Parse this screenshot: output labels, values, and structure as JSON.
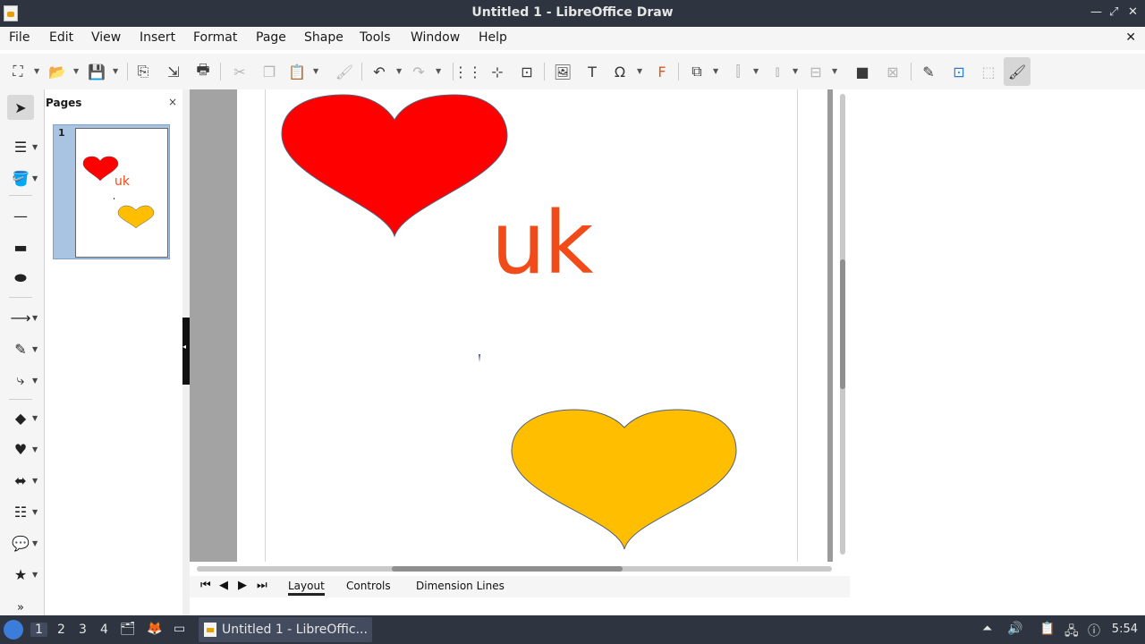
{
  "window": {
    "title": "Untitled 1 - LibreOffice Draw",
    "minimize_glyph": "—",
    "maximize_glyph": "⤢",
    "close_glyph": "✕"
  },
  "menubar": {
    "items": [
      "File",
      "Edit",
      "View",
      "Insert",
      "Format",
      "Page",
      "Shape",
      "Tools",
      "Window",
      "Help"
    ],
    "doc_close_glyph": "✕"
  },
  "toolbar": {
    "icons": [
      "select-mode-icon",
      "open-icon",
      "save-icon",
      "export-icon",
      "export-pdf-icon",
      "print-icon",
      "cut-icon",
      "copy-icon",
      "paste-icon",
      "clone-formatting-icon",
      "undo-icon",
      "redo-icon",
      "grid-icon",
      "helplines-icon",
      "zoom-pan-icon",
      "insert-image-icon",
      "insert-textbox-icon",
      "special-character-icon",
      "fontwork-icon",
      "transformations-icon",
      "align-icon",
      "arrange-icon",
      "distribute-icon",
      "shadow-icon",
      "crop-icon",
      "points-icon",
      "glue-points-icon",
      "toggle-extrusion-icon",
      "show-draw-functions-icon"
    ]
  },
  "pages_panel": {
    "header": "Pages",
    "close_glyph": "×",
    "pages": [
      {
        "number": "1",
        "thumb_text": "uk"
      }
    ]
  },
  "drawing": {
    "text_object": "uk",
    "shapes": [
      {
        "name": "red-heart",
        "fill": "#ff0000"
      },
      {
        "name": "yellow-heart",
        "fill": "#ffbf00"
      }
    ],
    "text_color": "#f04b18"
  },
  "tabs": {
    "nav": [
      "⏮",
      "◀",
      "▶",
      "⏭"
    ],
    "layers": [
      "Layout",
      "Controls",
      "Dimension Lines"
    ],
    "active_layer": "Layout"
  },
  "taskbar": {
    "workspaces": [
      "1",
      "2",
      "3",
      "4"
    ],
    "active_workspace": "1",
    "app_button": "Untitled 1 - LibreOffic...",
    "clock": "5:54"
  }
}
